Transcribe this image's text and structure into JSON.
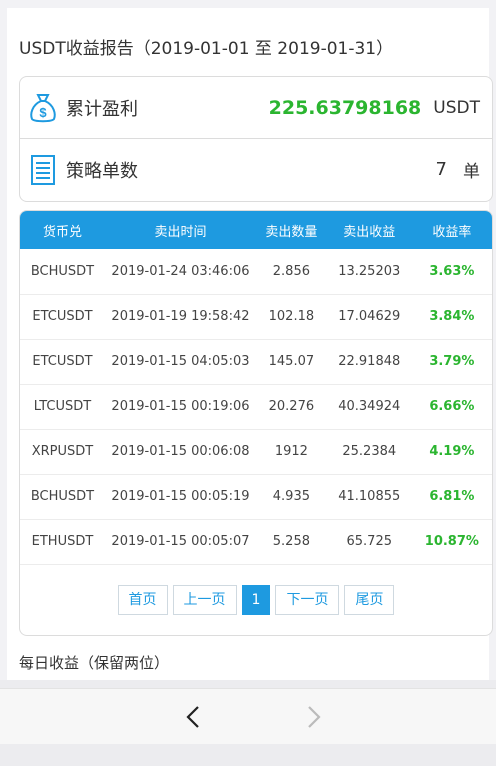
{
  "report": {
    "title": "USDT收益报告（2019-01-01 至 2019-01-31）"
  },
  "summary": {
    "profit_label": "累计盈利",
    "profit_value": "225.63798168",
    "profit_unit": "USDT",
    "strategy_label": "策略单数",
    "strategy_count": "7",
    "strategy_unit": "单",
    "profit_icon": "money-bag-icon",
    "strategy_icon": "document-icon",
    "accent_green": "#2bb530"
  },
  "table": {
    "headers": [
      "货币兑",
      "卖出时间",
      "卖出数量",
      "卖出收益",
      "收益率"
    ],
    "header_color": "#1e9ae0",
    "rows": [
      [
        "BCHUSDT",
        "2019-01-24 03:46:06",
        "2.856",
        "13.25203",
        "3.63%"
      ],
      [
        "ETCUSDT",
        "2019-01-19 19:58:42",
        "102.18",
        "17.04629",
        "3.84%"
      ],
      [
        "ETCUSDT",
        "2019-01-15 04:05:03",
        "145.07",
        "22.91848",
        "3.79%"
      ],
      [
        "LTCUSDT",
        "2019-01-15 00:19:06",
        "20.276",
        "40.34924",
        "6.66%"
      ],
      [
        "XRPUSDT",
        "2019-01-15 00:06:08",
        "1912",
        "25.2384",
        "4.19%"
      ],
      [
        "BCHUSDT",
        "2019-01-15 00:05:19",
        "4.935",
        "41.10855",
        "6.81%"
      ],
      [
        "ETHUSDT",
        "2019-01-15 00:05:07",
        "5.258",
        "65.725",
        "10.87%"
      ]
    ]
  },
  "pager": {
    "first": "首页",
    "prev": "上一页",
    "current": "1",
    "next": "下一页",
    "last": "尾页"
  },
  "daily": {
    "title": "每日收益（保留两位）"
  },
  "nav": {
    "back_icon": "chevron-left-icon",
    "forward_icon": "chevron-right-icon"
  }
}
